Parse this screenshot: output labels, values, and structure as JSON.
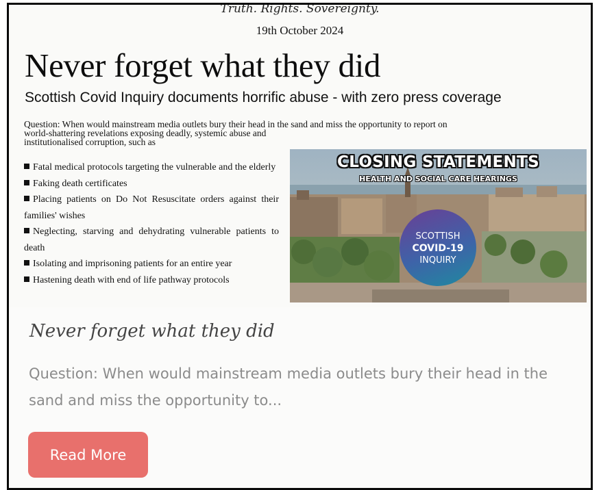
{
  "clipping": {
    "motto": "Truth. Rights. Sovereignty.",
    "date": "19th October 2024",
    "headline": "Never forget what they did",
    "subheadline": "Scottish Covid Inquiry documents horrific abuse - with zero press coverage",
    "lead_line1": "Question: When would mainstream media outlets bury their head in the sand and miss the opportunity to report on",
    "lead_line2": "world-shattering revelations exposing deadly, systemic abuse and institutionalised corruption, such as",
    "bullets": [
      "Fatal medical protocols targeting the vulnerable and the elderly",
      "Faking death certificates",
      "Placing patients on Do Not Resuscitate orders against their families' wishes",
      "Neglecting, starving and dehydrating vulnerable patients to death",
      "Isolating and imprisoning patients for an entire year",
      "Hastening death with end of life pathway protocols"
    ],
    "promo": {
      "title": "CLOSING STATEMENTS",
      "subtitle": "HEALTH AND SOCIAL CARE HEARINGS",
      "badge_line1": "SCOTTISH",
      "badge_line2": "COVID-19",
      "badge_line3": "INQUIRY"
    }
  },
  "card": {
    "title": "Never forget what they did",
    "excerpt": "Question: When would mainstream media outlets bury their head in the sand and miss the opportunity to...",
    "read_more_label": "Read More",
    "button_color": "#e8706c"
  }
}
